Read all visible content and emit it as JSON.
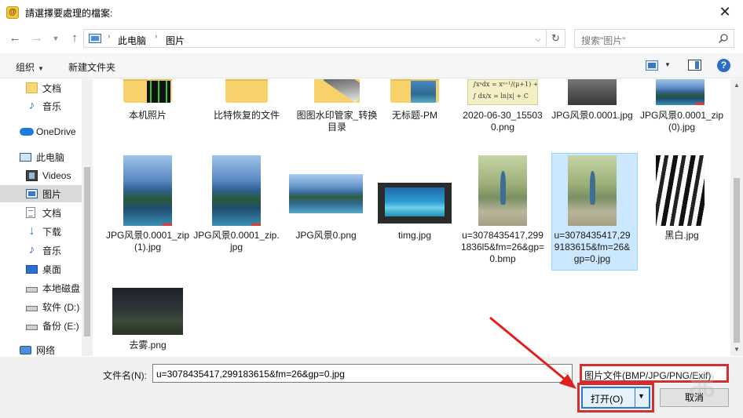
{
  "window": {
    "title": "請選擇要處理的檔案:",
    "close_glyph": "✕"
  },
  "address": {
    "crumbs": [
      "此电脑",
      "图片"
    ],
    "search_placeholder": "搜索\"图片\""
  },
  "toolbar": {
    "organize": "组织",
    "new_folder": "新建文件夹"
  },
  "sidebar": {
    "items": [
      {
        "label": "文档",
        "icon": "folder-icon"
      },
      {
        "label": "音乐",
        "icon": "music-icon"
      },
      {
        "label": "OneDrive",
        "icon": "cloud-icon"
      },
      {
        "label": "此电脑",
        "icon": "computer-icon"
      },
      {
        "label": "Videos",
        "icon": "video-icon"
      },
      {
        "label": "图片",
        "icon": "pictures-icon",
        "selected": true
      },
      {
        "label": "文档",
        "icon": "document-icon"
      },
      {
        "label": "下载",
        "icon": "download-icon"
      },
      {
        "label": "音乐",
        "icon": "music-icon"
      },
      {
        "label": "桌面",
        "icon": "desktop-icon"
      },
      {
        "label": "本地磁盘",
        "icon": "drive-icon"
      },
      {
        "label": "软件 (D:)",
        "icon": "drive-icon"
      },
      {
        "label": "备份 (E:)",
        "icon": "drive-icon"
      },
      {
        "label": "网络",
        "icon": "network-icon"
      }
    ]
  },
  "files": [
    {
      "name": "本机照片",
      "kind": "folder"
    },
    {
      "name": "比特恢复的文件",
      "kind": "folder"
    },
    {
      "name": "图图水印管家_转换目录",
      "kind": "folder"
    },
    {
      "name": "无标题-PM",
      "kind": "folder"
    },
    {
      "name": "2020-06-30_155030.png",
      "kind": "image"
    },
    {
      "name": "JPG风景0.0001.jpg",
      "kind": "image"
    },
    {
      "name": "JPG风景0.0001_zip(0).jpg",
      "kind": "image"
    },
    {
      "name": "JPG风景0.0001_zip(1).jpg",
      "kind": "image"
    },
    {
      "name": "JPG风景0.0001_zip.jpg",
      "kind": "image"
    },
    {
      "name": "JPG风景0.png",
      "kind": "image"
    },
    {
      "name": "timg.jpg",
      "kind": "image"
    },
    {
      "name": "u=3078435417,2991836l5&fm=26&gp=0.bmp",
      "kind": "image"
    },
    {
      "name": "u=3078435417,299183615&fm=26&gp=0.jpg",
      "kind": "image",
      "selected": true
    },
    {
      "name": "黑白.jpg",
      "kind": "image"
    },
    {
      "name": "去雾.png",
      "kind": "image"
    }
  ],
  "bottom": {
    "filename_label": "文件名(N):",
    "filename_value": "u=3078435417,299183615&fm=26&gp=0.jpg",
    "filetype_value": "图片文件(BMP/JPG/PNG/Exif)",
    "open_label": "打开(O)",
    "cancel_label": "取消"
  },
  "colors": {
    "highlight_red": "#d32f2f",
    "selection_blue": "#cce8ff",
    "accent_blue": "#2b79d0"
  }
}
